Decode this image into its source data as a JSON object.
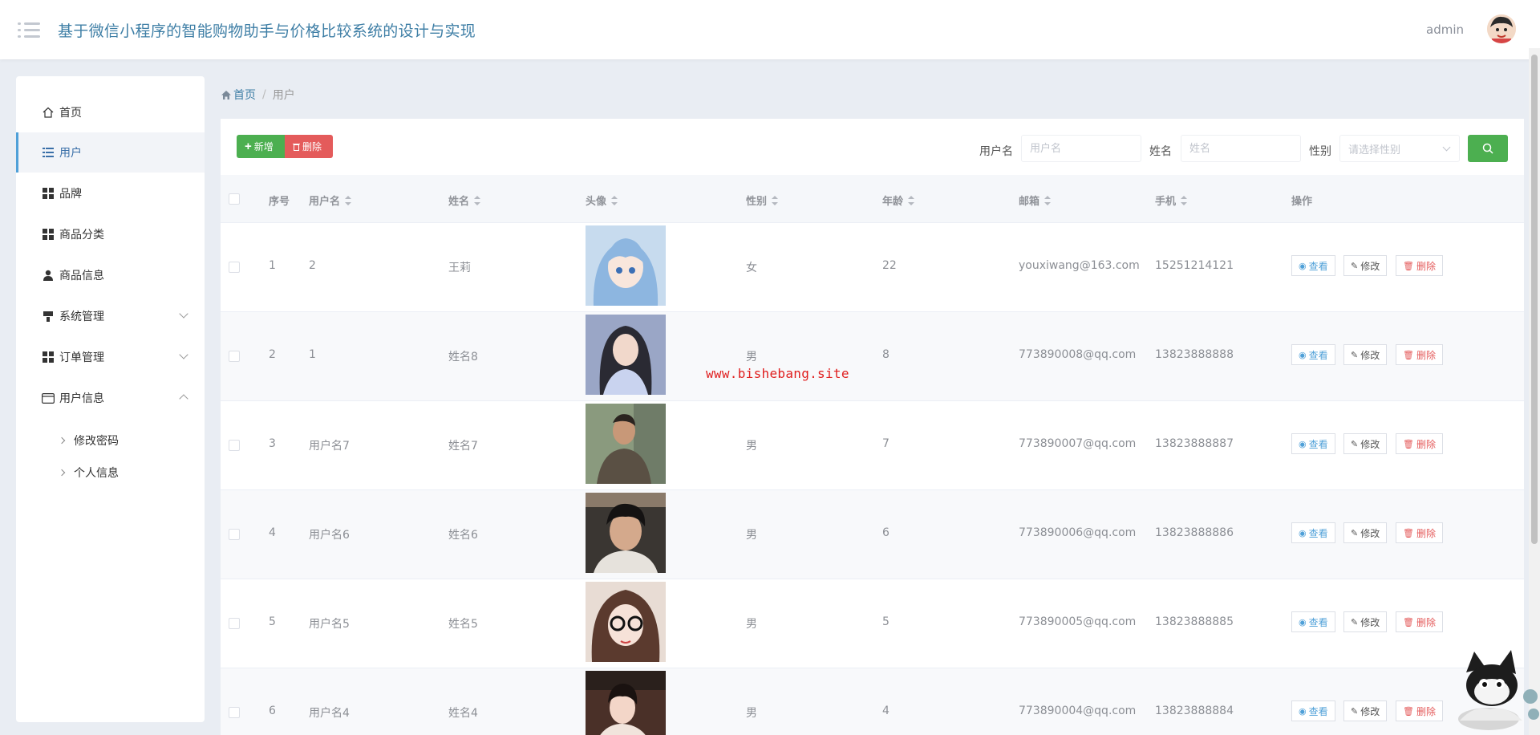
{
  "header": {
    "title": "基于微信小程序的智能购物助手与价格比较系统的设计与实现",
    "user": "admin"
  },
  "sidebar": {
    "items": [
      {
        "label": "首页",
        "icon": "home-icon"
      },
      {
        "label": "用户",
        "icon": "list-icon"
      },
      {
        "label": "品牌",
        "icon": "grid-icon"
      },
      {
        "label": "商品分类",
        "icon": "grid-icon"
      },
      {
        "label": "商品信息",
        "icon": "user-icon"
      },
      {
        "label": "系统管理",
        "icon": "brush-icon"
      },
      {
        "label": "订单管理",
        "icon": "grid-icon"
      },
      {
        "label": "用户信息",
        "icon": "card-icon"
      }
    ],
    "sub_items": [
      "修改密码",
      "个人信息"
    ]
  },
  "breadcrumb": {
    "home": "首页",
    "current": "用户"
  },
  "toolbar": {
    "add_label": "新增",
    "delete_label": "删除"
  },
  "filters": {
    "username_label": "用户名",
    "username_placeholder": "用户名",
    "name_label": "姓名",
    "name_placeholder": "姓名",
    "gender_label": "性别",
    "gender_placeholder": "请选择性别"
  },
  "table": {
    "columns": [
      "序号",
      "用户名",
      "姓名",
      "头像",
      "性别",
      "年龄",
      "邮箱",
      "手机",
      "操作"
    ],
    "rows": [
      {
        "index": "1",
        "username": "2",
        "name": "王莉",
        "gender": "女",
        "age": "22",
        "email": "youxiwang@163.com",
        "phone": "15251214121"
      },
      {
        "index": "2",
        "username": "1",
        "name": "姓名8",
        "gender": "男",
        "age": "8",
        "email": "773890008@qq.com",
        "phone": "13823888888"
      },
      {
        "index": "3",
        "username": "用户名7",
        "name": "姓名7",
        "gender": "男",
        "age": "7",
        "email": "773890007@qq.com",
        "phone": "13823888887"
      },
      {
        "index": "4",
        "username": "用户名6",
        "name": "姓名6",
        "gender": "男",
        "age": "6",
        "email": "773890006@qq.com",
        "phone": "13823888886"
      },
      {
        "index": "5",
        "username": "用户名5",
        "name": "姓名5",
        "gender": "男",
        "age": "5",
        "email": "773890005@qq.com",
        "phone": "13823888885"
      },
      {
        "index": "6",
        "username": "用户名4",
        "name": "姓名4",
        "gender": "男",
        "age": "4",
        "email": "773890004@qq.com",
        "phone": "13823888884"
      }
    ],
    "actions": {
      "view": "查看",
      "edit": "修改",
      "delete": "删除"
    }
  },
  "watermark": "www.bishebang.site",
  "colors": {
    "accent_green": "#4caf50",
    "danger_red": "#e45b5b",
    "link_blue": "#3f7fa6"
  }
}
